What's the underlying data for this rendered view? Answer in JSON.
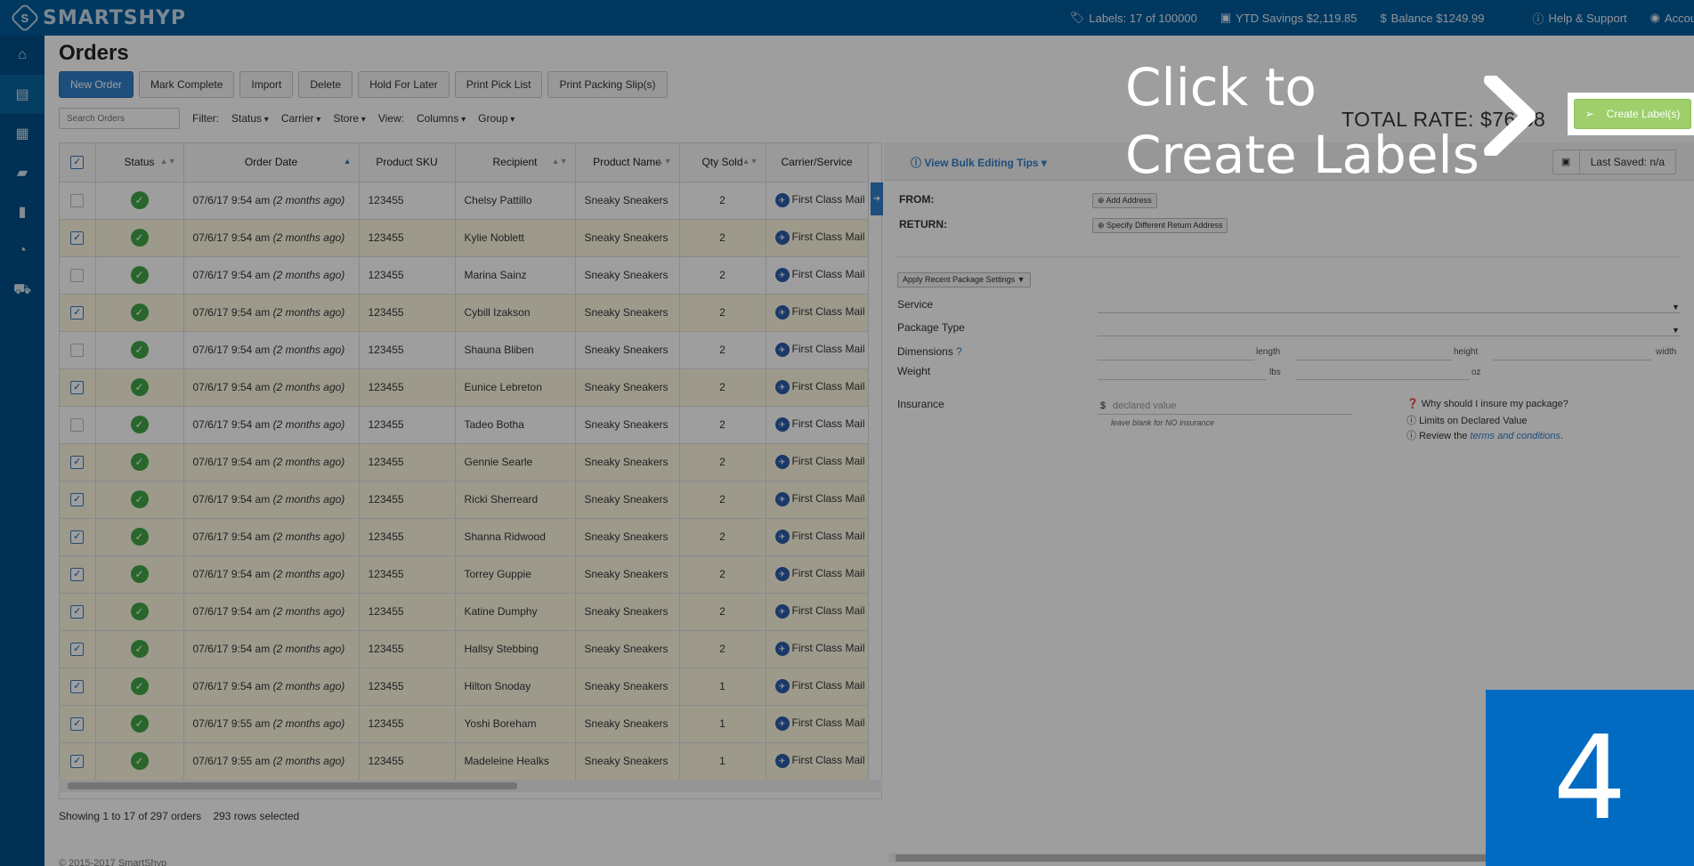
{
  "brand": {
    "name": "SMARTSHYP",
    "mark": "S"
  },
  "topbar": {
    "labels": "Labels: 17 of 100000",
    "ytd_savings": "YTD Savings $2,119.85",
    "balance": "Balance $1249.99",
    "help": "Help & Support",
    "account": "Account"
  },
  "sidebar": {
    "items": [
      "home-icon",
      "orders-icon",
      "calendar-icon",
      "truck-icon",
      "address-book-icon",
      "reports-icon",
      "cart-icon"
    ]
  },
  "page": {
    "title": "Orders"
  },
  "toolbar": {
    "new_order": "New Order",
    "mark_complete": "Mark Complete",
    "import": "Import",
    "delete": "Delete",
    "hold": "Hold For Later",
    "pick_list": "Print Pick List",
    "packing_slip": "Print Packing Slip(s)"
  },
  "filters": {
    "search_placeholder": "Search Orders",
    "filter_label": "Filter:",
    "status": "Status",
    "carrier": "Carrier",
    "store": "Store",
    "view_label": "View:",
    "columns": "Columns",
    "group": "Group"
  },
  "table": {
    "headers": [
      "Status",
      "Order Date",
      "Product SKU",
      "Recipient",
      "Product Name",
      "Qty Sold",
      "Carrier/Service"
    ],
    "rows": [
      {
        "selected": false,
        "date": "07/6/17 9:54 am",
        "rel": "(2 months ago)",
        "sku": "123455",
        "recipient": "Chelsy Pattillo",
        "product": "Sneaky Sneakers",
        "qty": "2",
        "carrier": "First Class Mail"
      },
      {
        "selected": true,
        "date": "07/6/17 9:54 am",
        "rel": "(2 months ago)",
        "sku": "123455",
        "recipient": "Kylie Noblett",
        "product": "Sneaky Sneakers",
        "qty": "2",
        "carrier": "First Class Mail"
      },
      {
        "selected": false,
        "date": "07/6/17 9:54 am",
        "rel": "(2 months ago)",
        "sku": "123455",
        "recipient": "Marina Sainz",
        "product": "Sneaky Sneakers",
        "qty": "2",
        "carrier": "First Class Mail"
      },
      {
        "selected": true,
        "date": "07/6/17 9:54 am",
        "rel": "(2 months ago)",
        "sku": "123455",
        "recipient": "Cybill Izakson",
        "product": "Sneaky Sneakers",
        "qty": "2",
        "carrier": "First Class Mail"
      },
      {
        "selected": false,
        "date": "07/6/17 9:54 am",
        "rel": "(2 months ago)",
        "sku": "123455",
        "recipient": "Shauna Bliben",
        "product": "Sneaky Sneakers",
        "qty": "2",
        "carrier": "First Class Mail"
      },
      {
        "selected": true,
        "date": "07/6/17 9:54 am",
        "rel": "(2 months ago)",
        "sku": "123455",
        "recipient": "Eunice Lebreton",
        "product": "Sneaky Sneakers",
        "qty": "2",
        "carrier": "First Class Mail"
      },
      {
        "selected": false,
        "date": "07/6/17 9:54 am",
        "rel": "(2 months ago)",
        "sku": "123455",
        "recipient": "Tadeo Botha",
        "product": "Sneaky Sneakers",
        "qty": "2",
        "carrier": "First Class Mail"
      },
      {
        "selected": true,
        "date": "07/6/17 9:54 am",
        "rel": "(2 months ago)",
        "sku": "123455",
        "recipient": "Gennie Searle",
        "product": "Sneaky Sneakers",
        "qty": "2",
        "carrier": "First Class Mail"
      },
      {
        "selected": true,
        "date": "07/6/17 9:54 am",
        "rel": "(2 months ago)",
        "sku": "123455",
        "recipient": "Ricki Sherreard",
        "product": "Sneaky Sneakers",
        "qty": "2",
        "carrier": "First Class Mail"
      },
      {
        "selected": true,
        "date": "07/6/17 9:54 am",
        "rel": "(2 months ago)",
        "sku": "123455",
        "recipient": "Shanna Ridwood",
        "product": "Sneaky Sneakers",
        "qty": "2",
        "carrier": "First Class Mail"
      },
      {
        "selected": true,
        "date": "07/6/17 9:54 am",
        "rel": "(2 months ago)",
        "sku": "123455",
        "recipient": "Torrey Guppie",
        "product": "Sneaky Sneakers",
        "qty": "2",
        "carrier": "First Class Mail"
      },
      {
        "selected": true,
        "date": "07/6/17 9:54 am",
        "rel": "(2 months ago)",
        "sku": "123455",
        "recipient": "Katine Dumphy",
        "product": "Sneaky Sneakers",
        "qty": "2",
        "carrier": "First Class Mail"
      },
      {
        "selected": true,
        "date": "07/6/17 9:54 am",
        "rel": "(2 months ago)",
        "sku": "123455",
        "recipient": "Hallsy Stebbing",
        "product": "Sneaky Sneakers",
        "qty": "2",
        "carrier": "First Class Mail"
      },
      {
        "selected": true,
        "date": "07/6/17 9:54 am",
        "rel": "(2 months ago)",
        "sku": "123455",
        "recipient": "Hilton Snoday",
        "product": "Sneaky Sneakers",
        "qty": "1",
        "carrier": "First Class Mail"
      },
      {
        "selected": true,
        "date": "07/6/17 9:55 am",
        "rel": "(2 months ago)",
        "sku": "123455",
        "recipient": "Yoshi Boreham",
        "product": "Sneaky Sneakers",
        "qty": "1",
        "carrier": "First Class Mail"
      },
      {
        "selected": true,
        "date": "07/6/17 9:55 am",
        "rel": "(2 months ago)",
        "sku": "123455",
        "recipient": "Madeleine Healks",
        "product": "Sneaky Sneakers",
        "qty": "1",
        "carrier": "First Class Mail"
      }
    ]
  },
  "footer": {
    "showing": "Showing 1 to 17 of 297 orders",
    "selected": "293 rows selected",
    "copyright": "© 2015-2017 SmartShyp"
  },
  "panel": {
    "tips": "View Bulk Editing Tips",
    "last_saved": "Last Saved: n/a",
    "from": "FROM:",
    "return": "RETURN:",
    "add_address": "Add Address",
    "diff_return": "Specify Different Return Address",
    "recent_settings": "Apply Recent Package Settings",
    "service": "Service",
    "package_type": "Package Type",
    "dimensions": "Dimensions",
    "weight": "Weight",
    "length": "length",
    "height": "height",
    "width": "width",
    "lbs": "lbs",
    "oz": "oz",
    "insurance": "Insurance",
    "currency": "$",
    "declared_placeholder": "declared value",
    "insurance_hint": "leave blank for NO insurance",
    "why_insure": "Why should I insure my package?",
    "limits": "Limits on Declared Value",
    "review": "Review the",
    "terms": "terms and conditions",
    "total_rate": "TOTAL RATE: $76.88",
    "create_labels": "Create Label(s)"
  },
  "tutorial": {
    "line1": "Click to",
    "line2": "Create Labels",
    "step": "4"
  },
  "colors": {
    "topbar": "#005b9b",
    "sidebar": "#004e87",
    "primary": "#2f7fc9",
    "success": "#43a547",
    "create": "#9ecf6b",
    "step_badge": "#006bc0"
  }
}
